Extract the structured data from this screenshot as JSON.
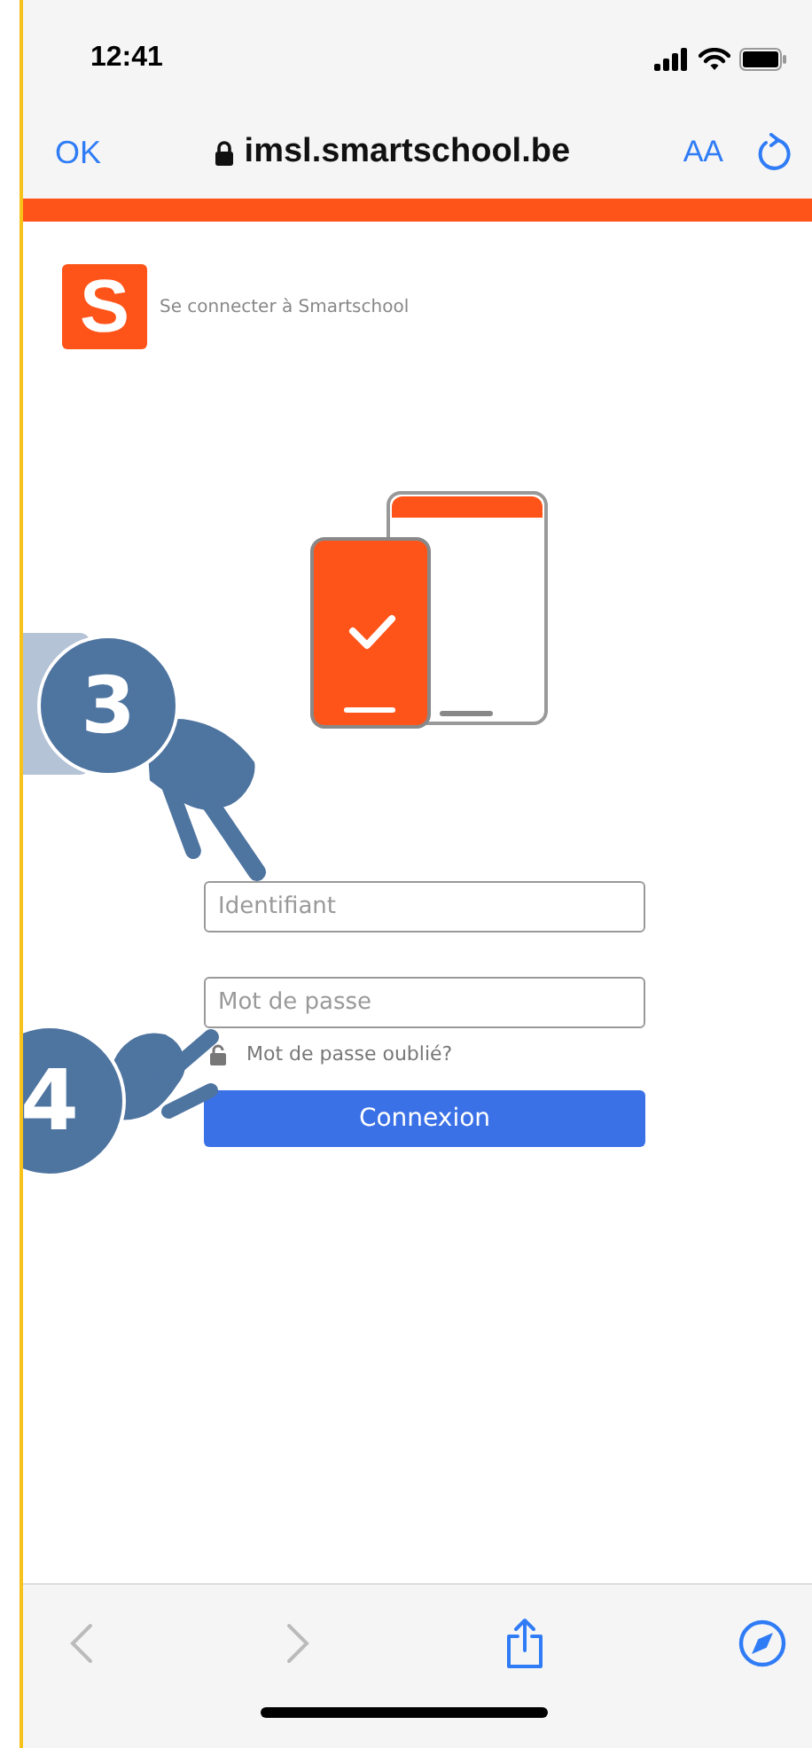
{
  "status_bar": {
    "time": "12:41"
  },
  "browser_bar": {
    "done": "OK",
    "url": "imsl.smartschool.be",
    "text_size": "AA"
  },
  "login": {
    "logo": "S",
    "title": "Se connecter à Smartschool",
    "fields": [
      {
        "kind": "text",
        "placeholder": "Identifiant"
      },
      {
        "kind": "password",
        "placeholder": "Mot de passe"
      }
    ],
    "forgot_link": "Mot de passe oublié?",
    "submit": "Connexion"
  },
  "toolbar": {
    "back_disabled": true,
    "forward_disabled": true
  },
  "annotations": [
    {
      "number": "3"
    },
    {
      "number": "4"
    }
  ]
}
